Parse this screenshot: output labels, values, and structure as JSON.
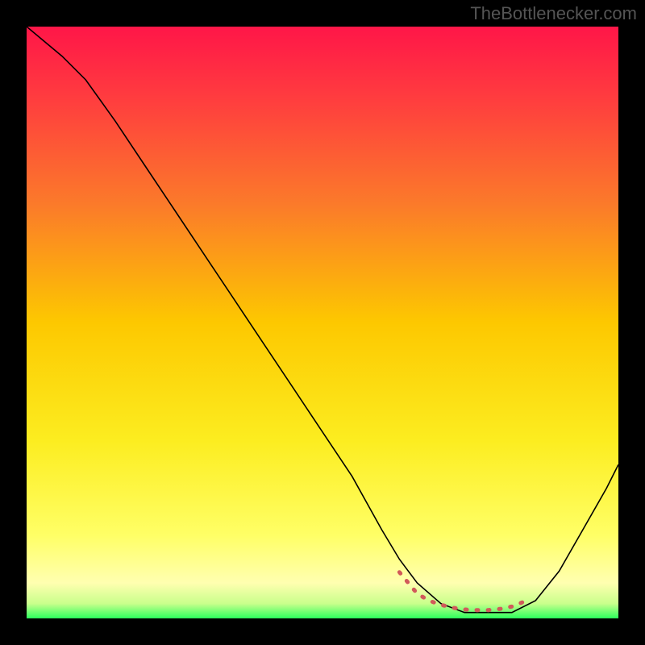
{
  "watermark": "TheBottlenecker.com",
  "chart_data": {
    "type": "line",
    "title": "",
    "xlabel": "",
    "ylabel": "",
    "xlim": [
      0,
      100
    ],
    "ylim": [
      0,
      100
    ],
    "background": {
      "type": "vertical-gradient",
      "stops": [
        {
          "pos": 0,
          "color": "#ff1648"
        },
        {
          "pos": 50,
          "color": "#fdc800"
        },
        {
          "pos": 85,
          "color": "#ffff66"
        },
        {
          "pos": 96,
          "color": "#ffffa0"
        },
        {
          "pos": 100,
          "color": "#2cff5c"
        }
      ]
    },
    "series": [
      {
        "name": "bottleneck-curve",
        "color": "#000000",
        "width": 1.5,
        "x": [
          0,
          3,
          6,
          10,
          15,
          20,
          25,
          30,
          35,
          40,
          45,
          50,
          55,
          60,
          63,
          66,
          70,
          74,
          78,
          82,
          86,
          90,
          94,
          98,
          100
        ],
        "y": [
          100,
          97.5,
          95,
          91,
          84,
          76.5,
          69,
          61.5,
          54,
          46.5,
          39,
          31.5,
          24,
          15,
          10,
          6,
          2.5,
          1,
          1,
          1,
          3,
          8,
          15,
          22,
          26
        ]
      },
      {
        "name": "optimal-range-marker",
        "color": "#d15a5a",
        "width": 5,
        "style": "dashed",
        "x": [
          63,
          66,
          68,
          70,
          72,
          74,
          76,
          78,
          80,
          82,
          84,
          85
        ],
        "y": [
          7.8,
          4.2,
          3.0,
          2.3,
          1.8,
          1.5,
          1.4,
          1.4,
          1.6,
          2.0,
          2.8,
          3.5
        ]
      }
    ]
  }
}
